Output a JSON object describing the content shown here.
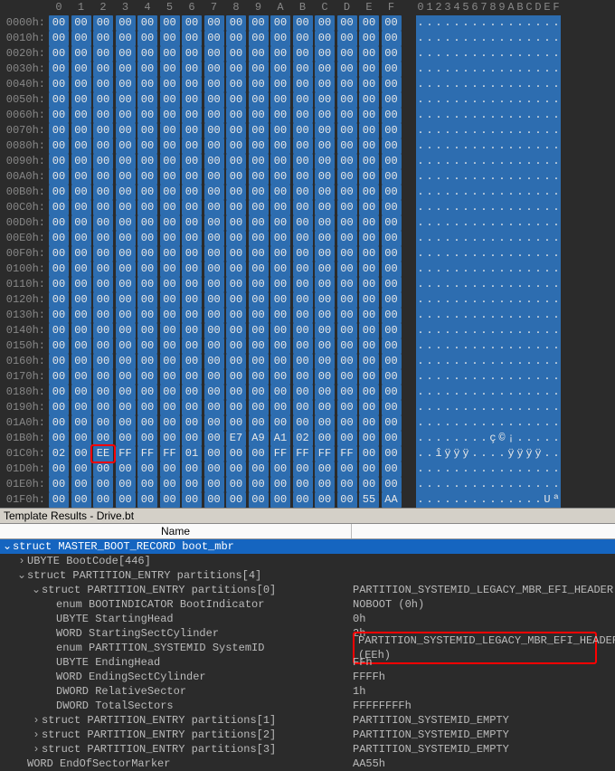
{
  "hex": {
    "col_headers": [
      "0",
      "1",
      "2",
      "3",
      "4",
      "5",
      "6",
      "7",
      "8",
      "9",
      "A",
      "B",
      "C",
      "D",
      "E",
      "F"
    ],
    "ascii_header": "0123456789ABCDEF",
    "rows": [
      {
        "offset": "0000h:",
        "bytes": [
          "00",
          "00",
          "00",
          "00",
          "00",
          "00",
          "00",
          "00",
          "00",
          "00",
          "00",
          "00",
          "00",
          "00",
          "00",
          "00"
        ],
        "ascii": "................"
      },
      {
        "offset": "0010h:",
        "bytes": [
          "00",
          "00",
          "00",
          "00",
          "00",
          "00",
          "00",
          "00",
          "00",
          "00",
          "00",
          "00",
          "00",
          "00",
          "00",
          "00"
        ],
        "ascii": "................"
      },
      {
        "offset": "0020h:",
        "bytes": [
          "00",
          "00",
          "00",
          "00",
          "00",
          "00",
          "00",
          "00",
          "00",
          "00",
          "00",
          "00",
          "00",
          "00",
          "00",
          "00"
        ],
        "ascii": "................"
      },
      {
        "offset": "0030h:",
        "bytes": [
          "00",
          "00",
          "00",
          "00",
          "00",
          "00",
          "00",
          "00",
          "00",
          "00",
          "00",
          "00",
          "00",
          "00",
          "00",
          "00"
        ],
        "ascii": "................"
      },
      {
        "offset": "0040h:",
        "bytes": [
          "00",
          "00",
          "00",
          "00",
          "00",
          "00",
          "00",
          "00",
          "00",
          "00",
          "00",
          "00",
          "00",
          "00",
          "00",
          "00"
        ],
        "ascii": "................"
      },
      {
        "offset": "0050h:",
        "bytes": [
          "00",
          "00",
          "00",
          "00",
          "00",
          "00",
          "00",
          "00",
          "00",
          "00",
          "00",
          "00",
          "00",
          "00",
          "00",
          "00"
        ],
        "ascii": "................"
      },
      {
        "offset": "0060h:",
        "bytes": [
          "00",
          "00",
          "00",
          "00",
          "00",
          "00",
          "00",
          "00",
          "00",
          "00",
          "00",
          "00",
          "00",
          "00",
          "00",
          "00"
        ],
        "ascii": "................"
      },
      {
        "offset": "0070h:",
        "bytes": [
          "00",
          "00",
          "00",
          "00",
          "00",
          "00",
          "00",
          "00",
          "00",
          "00",
          "00",
          "00",
          "00",
          "00",
          "00",
          "00"
        ],
        "ascii": "................"
      },
      {
        "offset": "0080h:",
        "bytes": [
          "00",
          "00",
          "00",
          "00",
          "00",
          "00",
          "00",
          "00",
          "00",
          "00",
          "00",
          "00",
          "00",
          "00",
          "00",
          "00"
        ],
        "ascii": "................"
      },
      {
        "offset": "0090h:",
        "bytes": [
          "00",
          "00",
          "00",
          "00",
          "00",
          "00",
          "00",
          "00",
          "00",
          "00",
          "00",
          "00",
          "00",
          "00",
          "00",
          "00"
        ],
        "ascii": "................"
      },
      {
        "offset": "00A0h:",
        "bytes": [
          "00",
          "00",
          "00",
          "00",
          "00",
          "00",
          "00",
          "00",
          "00",
          "00",
          "00",
          "00",
          "00",
          "00",
          "00",
          "00"
        ],
        "ascii": "................"
      },
      {
        "offset": "00B0h:",
        "bytes": [
          "00",
          "00",
          "00",
          "00",
          "00",
          "00",
          "00",
          "00",
          "00",
          "00",
          "00",
          "00",
          "00",
          "00",
          "00",
          "00"
        ],
        "ascii": "................"
      },
      {
        "offset": "00C0h:",
        "bytes": [
          "00",
          "00",
          "00",
          "00",
          "00",
          "00",
          "00",
          "00",
          "00",
          "00",
          "00",
          "00",
          "00",
          "00",
          "00",
          "00"
        ],
        "ascii": "................"
      },
      {
        "offset": "00D0h:",
        "bytes": [
          "00",
          "00",
          "00",
          "00",
          "00",
          "00",
          "00",
          "00",
          "00",
          "00",
          "00",
          "00",
          "00",
          "00",
          "00",
          "00"
        ],
        "ascii": "................"
      },
      {
        "offset": "00E0h:",
        "bytes": [
          "00",
          "00",
          "00",
          "00",
          "00",
          "00",
          "00",
          "00",
          "00",
          "00",
          "00",
          "00",
          "00",
          "00",
          "00",
          "00"
        ],
        "ascii": "................"
      },
      {
        "offset": "00F0h:",
        "bytes": [
          "00",
          "00",
          "00",
          "00",
          "00",
          "00",
          "00",
          "00",
          "00",
          "00",
          "00",
          "00",
          "00",
          "00",
          "00",
          "00"
        ],
        "ascii": "................"
      },
      {
        "offset": "0100h:",
        "bytes": [
          "00",
          "00",
          "00",
          "00",
          "00",
          "00",
          "00",
          "00",
          "00",
          "00",
          "00",
          "00",
          "00",
          "00",
          "00",
          "00"
        ],
        "ascii": "................"
      },
      {
        "offset": "0110h:",
        "bytes": [
          "00",
          "00",
          "00",
          "00",
          "00",
          "00",
          "00",
          "00",
          "00",
          "00",
          "00",
          "00",
          "00",
          "00",
          "00",
          "00"
        ],
        "ascii": "................"
      },
      {
        "offset": "0120h:",
        "bytes": [
          "00",
          "00",
          "00",
          "00",
          "00",
          "00",
          "00",
          "00",
          "00",
          "00",
          "00",
          "00",
          "00",
          "00",
          "00",
          "00"
        ],
        "ascii": "................"
      },
      {
        "offset": "0130h:",
        "bytes": [
          "00",
          "00",
          "00",
          "00",
          "00",
          "00",
          "00",
          "00",
          "00",
          "00",
          "00",
          "00",
          "00",
          "00",
          "00",
          "00"
        ],
        "ascii": "................"
      },
      {
        "offset": "0140h:",
        "bytes": [
          "00",
          "00",
          "00",
          "00",
          "00",
          "00",
          "00",
          "00",
          "00",
          "00",
          "00",
          "00",
          "00",
          "00",
          "00",
          "00"
        ],
        "ascii": "................"
      },
      {
        "offset": "0150h:",
        "bytes": [
          "00",
          "00",
          "00",
          "00",
          "00",
          "00",
          "00",
          "00",
          "00",
          "00",
          "00",
          "00",
          "00",
          "00",
          "00",
          "00"
        ],
        "ascii": "................"
      },
      {
        "offset": "0160h:",
        "bytes": [
          "00",
          "00",
          "00",
          "00",
          "00",
          "00",
          "00",
          "00",
          "00",
          "00",
          "00",
          "00",
          "00",
          "00",
          "00",
          "00"
        ],
        "ascii": "................"
      },
      {
        "offset": "0170h:",
        "bytes": [
          "00",
          "00",
          "00",
          "00",
          "00",
          "00",
          "00",
          "00",
          "00",
          "00",
          "00",
          "00",
          "00",
          "00",
          "00",
          "00"
        ],
        "ascii": "................"
      },
      {
        "offset": "0180h:",
        "bytes": [
          "00",
          "00",
          "00",
          "00",
          "00",
          "00",
          "00",
          "00",
          "00",
          "00",
          "00",
          "00",
          "00",
          "00",
          "00",
          "00"
        ],
        "ascii": "................"
      },
      {
        "offset": "0190h:",
        "bytes": [
          "00",
          "00",
          "00",
          "00",
          "00",
          "00",
          "00",
          "00",
          "00",
          "00",
          "00",
          "00",
          "00",
          "00",
          "00",
          "00"
        ],
        "ascii": "................"
      },
      {
        "offset": "01A0h:",
        "bytes": [
          "00",
          "00",
          "00",
          "00",
          "00",
          "00",
          "00",
          "00",
          "00",
          "00",
          "00",
          "00",
          "00",
          "00",
          "00",
          "00"
        ],
        "ascii": "................"
      },
      {
        "offset": "01B0h:",
        "bytes": [
          "00",
          "00",
          "00",
          "00",
          "00",
          "00",
          "00",
          "00",
          "E7",
          "A9",
          "A1",
          "02",
          "00",
          "00",
          "00",
          "00"
        ],
        "ascii": "........ç©¡....."
      },
      {
        "offset": "01C0h:",
        "bytes": [
          "02",
          "00",
          "EE",
          "FF",
          "FF",
          "FF",
          "01",
          "00",
          "00",
          "00",
          "FF",
          "FF",
          "FF",
          "FF",
          "00",
          "00"
        ],
        "ascii": "..îÿÿÿ....ÿÿÿÿ.."
      },
      {
        "offset": "01D0h:",
        "bytes": [
          "00",
          "00",
          "00",
          "00",
          "00",
          "00",
          "00",
          "00",
          "00",
          "00",
          "00",
          "00",
          "00",
          "00",
          "00",
          "00"
        ],
        "ascii": "................"
      },
      {
        "offset": "01E0h:",
        "bytes": [
          "00",
          "00",
          "00",
          "00",
          "00",
          "00",
          "00",
          "00",
          "00",
          "00",
          "00",
          "00",
          "00",
          "00",
          "00",
          "00"
        ],
        "ascii": "................"
      },
      {
        "offset": "01F0h:",
        "bytes": [
          "00",
          "00",
          "00",
          "00",
          "00",
          "00",
          "00",
          "00",
          "00",
          "00",
          "00",
          "00",
          "00",
          "00",
          "55",
          "AA"
        ],
        "ascii": "..............Uª"
      }
    ],
    "highlight": {
      "row": 28,
      "col": 2
    }
  },
  "results": {
    "bar": "Template Results - Drive.bt",
    "header_name": "Name",
    "nodes": [
      {
        "indent": 0,
        "arrow": "⌄",
        "label": "struct MASTER_BOOT_RECORD boot_mbr",
        "value": "",
        "selected": true
      },
      {
        "indent": 1,
        "arrow": "›",
        "label": "UBYTE BootCode[446]",
        "value": ""
      },
      {
        "indent": 1,
        "arrow": "⌄",
        "label": "struct PARTITION_ENTRY partitions[4]",
        "value": ""
      },
      {
        "indent": 2,
        "arrow": "⌄",
        "label": "struct PARTITION_ENTRY partitions[0]",
        "value": "PARTITION_SYSTEMID_LEGACY_MBR_EFI_HEADER"
      },
      {
        "indent": 3,
        "arrow": "",
        "label": "enum BOOTINDICATOR BootIndicator",
        "value": "NOBOOT (0h)"
      },
      {
        "indent": 3,
        "arrow": "",
        "label": "UBYTE StartingHead",
        "value": "0h"
      },
      {
        "indent": 3,
        "arrow": "",
        "label": "WORD StartingSectCylinder",
        "value": "2h"
      },
      {
        "indent": 3,
        "arrow": "",
        "label": "enum PARTITION_SYSTEMID SystemID",
        "value": "PARTITION_SYSTEMID_LEGACY_MBR_EFI_HEADER (EEh)",
        "redbox": true
      },
      {
        "indent": 3,
        "arrow": "",
        "label": "UBYTE EndingHead",
        "value": "FFh"
      },
      {
        "indent": 3,
        "arrow": "",
        "label": "WORD EndingSectCylinder",
        "value": "FFFFh"
      },
      {
        "indent": 3,
        "arrow": "",
        "label": "DWORD RelativeSector",
        "value": "1h"
      },
      {
        "indent": 3,
        "arrow": "",
        "label": "DWORD TotalSectors",
        "value": "FFFFFFFFh"
      },
      {
        "indent": 2,
        "arrow": "›",
        "label": "struct PARTITION_ENTRY partitions[1]",
        "value": "PARTITION_SYSTEMID_EMPTY"
      },
      {
        "indent": 2,
        "arrow": "›",
        "label": "struct PARTITION_ENTRY partitions[2]",
        "value": "PARTITION_SYSTEMID_EMPTY"
      },
      {
        "indent": 2,
        "arrow": "›",
        "label": "struct PARTITION_ENTRY partitions[3]",
        "value": "PARTITION_SYSTEMID_EMPTY"
      },
      {
        "indent": 1,
        "arrow": "",
        "label": "WORD EndOfSectorMarker",
        "value": "AA55h"
      }
    ]
  }
}
